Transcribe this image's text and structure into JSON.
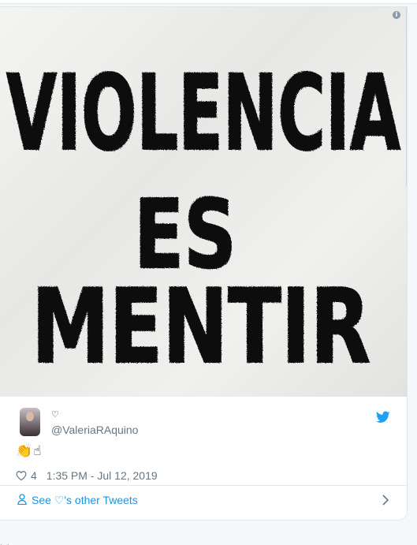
{
  "media": {
    "graffiti_lines": [
      "VIOLENCIA",
      "ES",
      "MENTIR"
    ],
    "info_icon": "info-icon"
  },
  "author": {
    "display_name": "♡",
    "handle": "@ValeriaRAquino",
    "verified": false
  },
  "tweet": {
    "text": "👏☝",
    "like_count": "4",
    "timestamp": "1:35 PM - Jul 12, 2019"
  },
  "footer": {
    "link_label": "See ♡'s other Tweets"
  },
  "below_card_text": "· ·",
  "colors": {
    "link": "#1b95e0",
    "twitter_blue": "#1da1f2",
    "muted": "#657786",
    "text": "#14171a",
    "border": "#e1e8ed"
  },
  "icons": [
    "info-icon",
    "twitter-bird-icon",
    "heart-icon",
    "person-icon",
    "chevron-right-icon"
  ]
}
